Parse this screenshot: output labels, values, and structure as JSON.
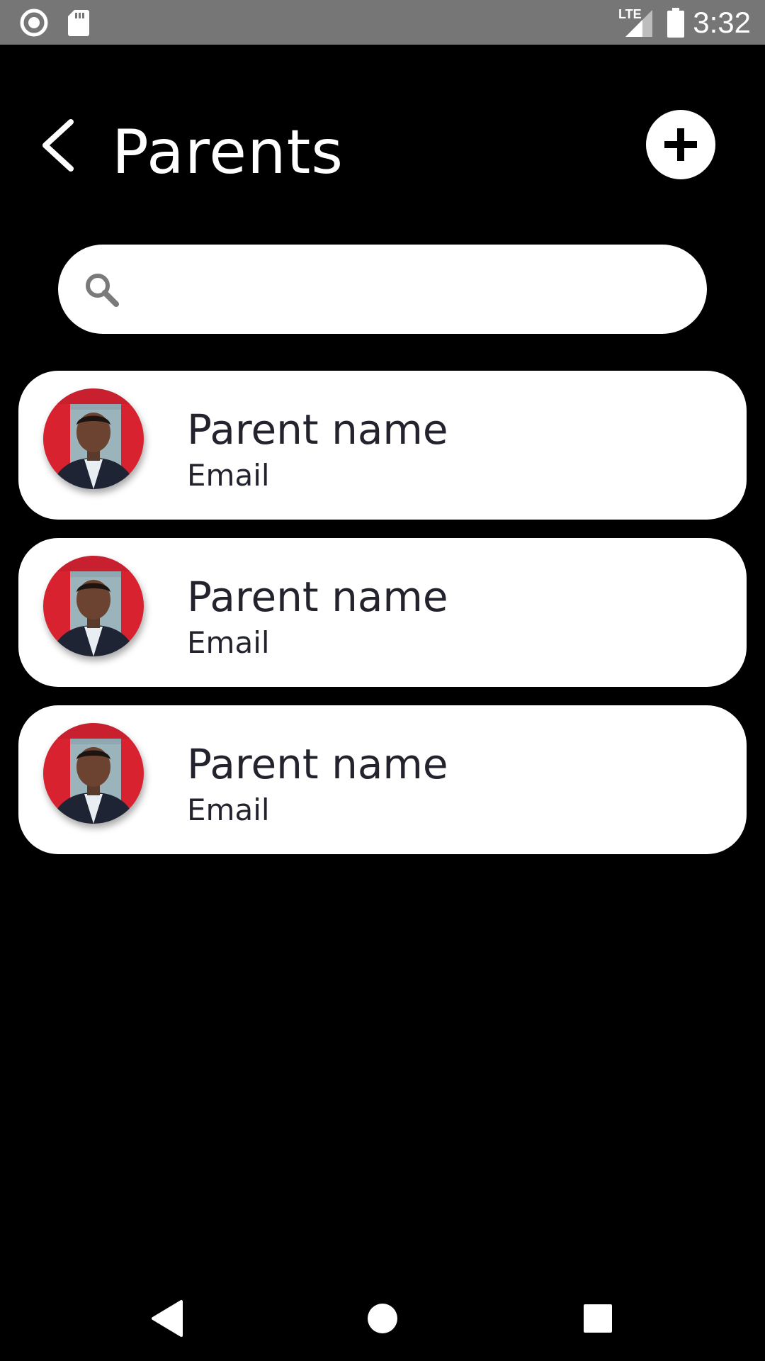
{
  "status_bar": {
    "time": "3:32",
    "network": "LTE",
    "icons": [
      "record-icon",
      "sd-card-icon",
      "lte-signal-icon",
      "battery-icon"
    ]
  },
  "header": {
    "title": "Parents",
    "back_icon": "chevron-left-icon",
    "add_icon": "plus-icon"
  },
  "search": {
    "placeholder": "",
    "value": "",
    "icon": "search-icon"
  },
  "parents": [
    {
      "name": "Parent name",
      "email": "Email"
    },
    {
      "name": "Parent name",
      "email": "Email"
    },
    {
      "name": "Parent name",
      "email": "Email"
    }
  ],
  "nav_bar": {
    "icons": [
      "back-triangle-icon",
      "home-circle-icon",
      "recents-square-icon"
    ]
  },
  "colors": {
    "background": "#000000",
    "status_bar": "#767676",
    "card": "#ffffff",
    "text_dark": "#22232d",
    "text_light": "#ffffff"
  }
}
